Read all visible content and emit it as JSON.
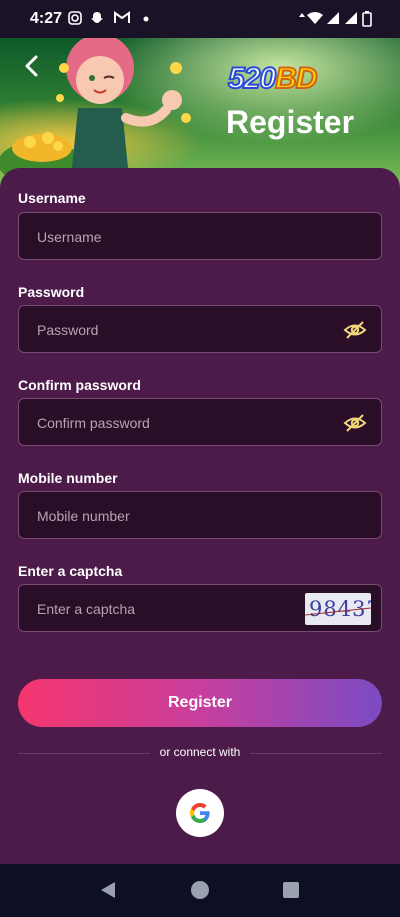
{
  "status_bar": {
    "time": "4:27"
  },
  "header": {
    "brand_num": "520",
    "brand_bd": "BD",
    "title": "Register"
  },
  "form": {
    "username": {
      "label": "Username",
      "placeholder": "Username"
    },
    "password": {
      "label": "Password",
      "placeholder": "Password"
    },
    "confirm_password": {
      "label": "Confirm password",
      "placeholder": "Confirm password"
    },
    "mobile": {
      "label": "Mobile number",
      "placeholder": "Mobile number"
    },
    "captcha": {
      "label": "Enter a captcha",
      "placeholder": "Enter a captcha",
      "code": "98437"
    }
  },
  "actions": {
    "register_label": "Register",
    "connect_text": "or connect with"
  },
  "colors": {
    "background": "#4c1b4a",
    "input_bg": "#2a0d26",
    "gradient_start": "#f5366e",
    "gradient_end": "#7b4bc3"
  },
  "icons": [
    "back-arrow-icon",
    "eye-slash-icon",
    "google-icon",
    "nav-back-icon",
    "nav-home-icon",
    "nav-recents-icon"
  ]
}
